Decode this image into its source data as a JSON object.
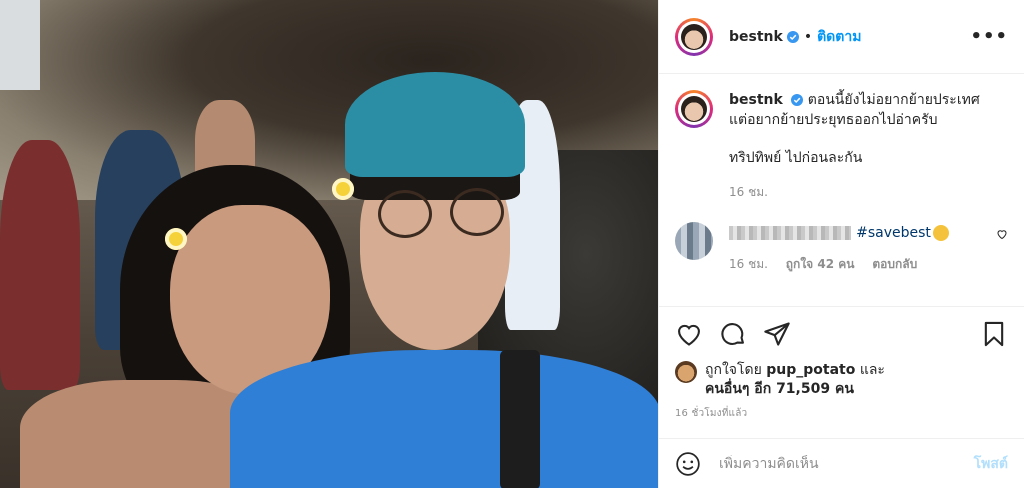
{
  "post": {
    "username": "bestnk",
    "follow_label": "ติดตาม",
    "dot": "•",
    "more_icon": "more-options-icon",
    "photo_description_icon": "post-photo"
  },
  "caption": {
    "username": "bestnk",
    "line1": "ตอนนี้ยังไม่อยากย้ายประเทศ",
    "line2": "แต่อยากย้ายประยุทธออกไปอ่าครับ",
    "line3": "ทริปทิพย์ ไปก่อนละกัน",
    "time": "16 ชม."
  },
  "comment": {
    "tag": "#savebest",
    "time": "16 ชม.",
    "likes": "ถูกใจ 42 คน",
    "reply": "ตอบกลับ"
  },
  "likes": {
    "line1_prefix": "ถูกใจโดย",
    "line1_user": "pup_potato",
    "line1_suffix": "และ",
    "line2": "คนอื่นๆ อีก 71,509 คน"
  },
  "post_time": "16 ชั่วโมงที่แล้ว",
  "add_comment": {
    "placeholder": "เพิ่มความคิดเห็น",
    "post_label": "โพสต์"
  },
  "colors": {
    "link_blue": "#0095f6",
    "verified_blue": "#3897f0",
    "muted": "#8e8e8e"
  }
}
